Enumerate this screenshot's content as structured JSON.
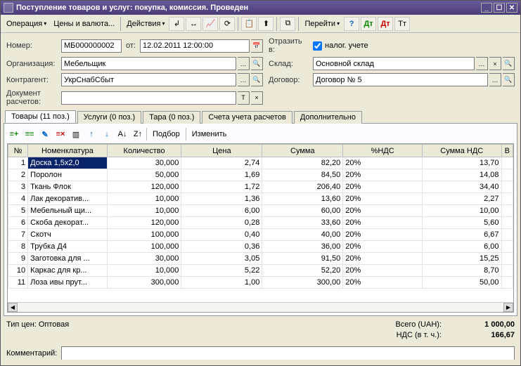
{
  "window": {
    "title": "Поступление товаров и услуг: покупка, комиссия. Проведен"
  },
  "menu": {
    "operation": "Операция",
    "prices": "Цены и валюта...",
    "actions": "Действия",
    "goto": "Перейти"
  },
  "fields": {
    "number_label": "Номер:",
    "number": "МБ000000002",
    "from_label": "от:",
    "date": "12.02.2011 12:00:00",
    "reflect_label": "Отразить в:",
    "reflect_check": "налог. учете",
    "org_label": "Организация:",
    "org": "Мебельщик",
    "warehouse_label": "Склад:",
    "warehouse": "Основной склад",
    "counterparty_label": "Контрагент:",
    "counterparty": "УкрСнабСбыт",
    "contract_label": "Договор:",
    "contract": "Договор № 5",
    "pay_doc_label": "Документ расчетов:"
  },
  "tabs": {
    "goods": "Товары (11 поз.)",
    "services": "Услуги (0 поз.)",
    "containers": "Тара (0 поз.)",
    "accounts": "Счета учета расчетов",
    "additional": "Дополнительно"
  },
  "table_toolbar": {
    "pick": "Подбор",
    "edit": "Изменить"
  },
  "columns": {
    "n": "№",
    "name": "Номенклатура",
    "qty": "Количество",
    "price": "Цена",
    "sum": "Сумма",
    "vat_pct": "%НДС",
    "vat_sum": "Сумма НДС",
    "total": "В"
  },
  "rows": [
    {
      "n": "1",
      "name": "Доска 1,5x2,0",
      "qty": "30,000",
      "price": "2,74",
      "sum": "82,20",
      "vat_pct": "20%",
      "vat_sum": "13,70"
    },
    {
      "n": "2",
      "name": "Поролон",
      "qty": "50,000",
      "price": "1,69",
      "sum": "84,50",
      "vat_pct": "20%",
      "vat_sum": "14,08"
    },
    {
      "n": "3",
      "name": "Ткань Флок",
      "qty": "120,000",
      "price": "1,72",
      "sum": "206,40",
      "vat_pct": "20%",
      "vat_sum": "34,40"
    },
    {
      "n": "4",
      "name": "Лак декоратив...",
      "qty": "10,000",
      "price": "1,36",
      "sum": "13,60",
      "vat_pct": "20%",
      "vat_sum": "2,27"
    },
    {
      "n": "5",
      "name": "Мебельный щи...",
      "qty": "10,000",
      "price": "6,00",
      "sum": "60,00",
      "vat_pct": "20%",
      "vat_sum": "10,00"
    },
    {
      "n": "6",
      "name": "Скоба декорат...",
      "qty": "120,000",
      "price": "0,28",
      "sum": "33,60",
      "vat_pct": "20%",
      "vat_sum": "5,60"
    },
    {
      "n": "7",
      "name": "Скотч",
      "qty": "100,000",
      "price": "0,40",
      "sum": "40,00",
      "vat_pct": "20%",
      "vat_sum": "6,67"
    },
    {
      "n": "8",
      "name": "Трубка Д4",
      "qty": "100,000",
      "price": "0,36",
      "sum": "36,00",
      "vat_pct": "20%",
      "vat_sum": "6,00"
    },
    {
      "n": "9",
      "name": "Заготовка для ...",
      "qty": "30,000",
      "price": "3,05",
      "sum": "91,50",
      "vat_pct": "20%",
      "vat_sum": "15,25"
    },
    {
      "n": "10",
      "name": "Каркас для кр...",
      "qty": "10,000",
      "price": "5,22",
      "sum": "52,20",
      "vat_pct": "20%",
      "vat_sum": "8,70"
    },
    {
      "n": "11",
      "name": "Лоза ивы прут...",
      "qty": "300,000",
      "price": "1,00",
      "sum": "300,00",
      "vat_pct": "20%",
      "vat_sum": "50,00"
    }
  ],
  "footer": {
    "price_type": "Тип цен: Оптовая",
    "total_label": "Всего (UAH):",
    "total": "1 000,00",
    "vat_label": "НДС (в т. ч.):",
    "vat": "166,67",
    "comment_label": "Комментарий:"
  }
}
